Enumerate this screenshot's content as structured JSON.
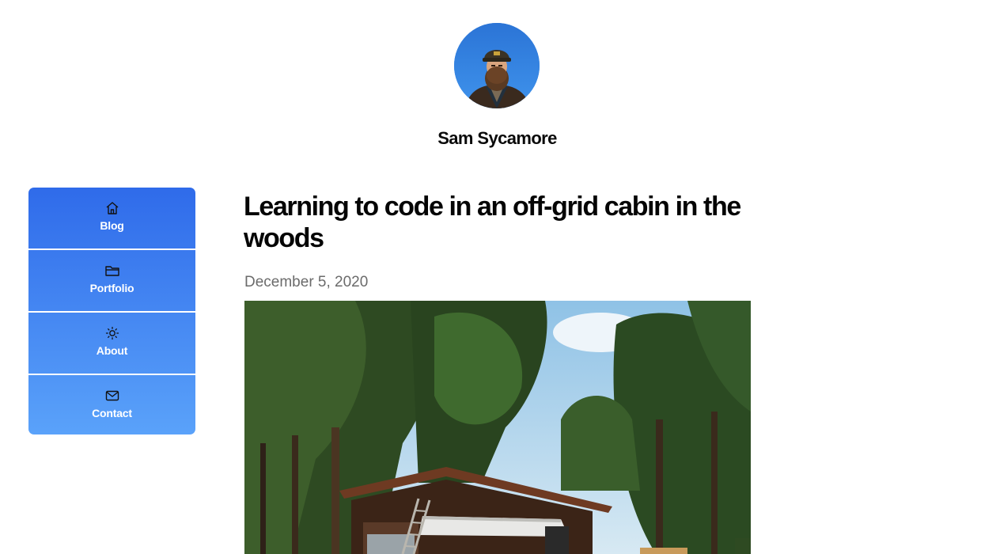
{
  "site": {
    "name": "Sam Sycamore",
    "avatar_icon": "profile-photo"
  },
  "nav": {
    "gradient_top": "#2f6bea",
    "gradient_bottom": "#5aa2fa",
    "items": [
      {
        "label": "Blog",
        "icon": "home-icon"
      },
      {
        "label": "Portfolio",
        "icon": "folder-icon"
      },
      {
        "label": "About",
        "icon": "sun-icon"
      },
      {
        "label": "Contact",
        "icon": "mail-icon"
      }
    ]
  },
  "post": {
    "title": "Learning to code in an off-grid cabin in the woods",
    "date": "December 5, 2020",
    "image_icon": "cabin-photo"
  }
}
